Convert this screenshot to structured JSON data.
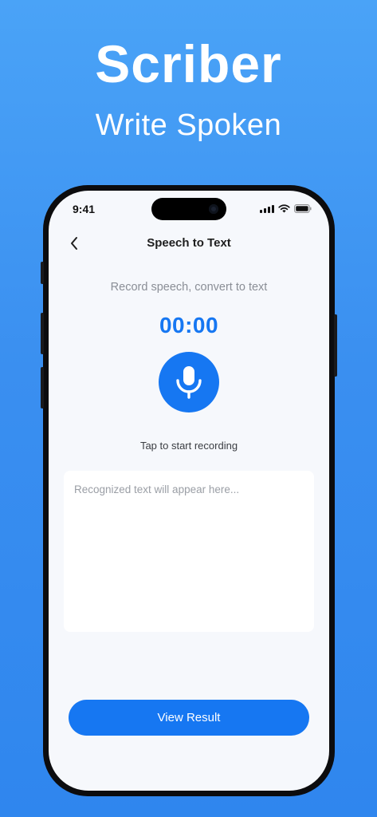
{
  "promo": {
    "app_name": "Scriber",
    "tagline": "Write Spoken"
  },
  "status_bar": {
    "time": "9:41",
    "icons": [
      "signal-icon",
      "wifi-icon",
      "battery-icon"
    ]
  },
  "nav": {
    "back_icon": "chevron-left-icon",
    "title": "Speech to Text"
  },
  "recorder": {
    "subtitle": "Record speech, convert to text",
    "timer": "00:00",
    "mic_icon": "microphone-icon",
    "hint": "Tap to start recording"
  },
  "result": {
    "value": "",
    "placeholder": "Recognized text will appear here..."
  },
  "actions": {
    "view_result_label": "View Result"
  },
  "colors": {
    "accent": "#1677f2",
    "background_top": "#4aa3f7",
    "background_bottom": "#2f86ee",
    "screen_bg": "#f6f8fc"
  }
}
